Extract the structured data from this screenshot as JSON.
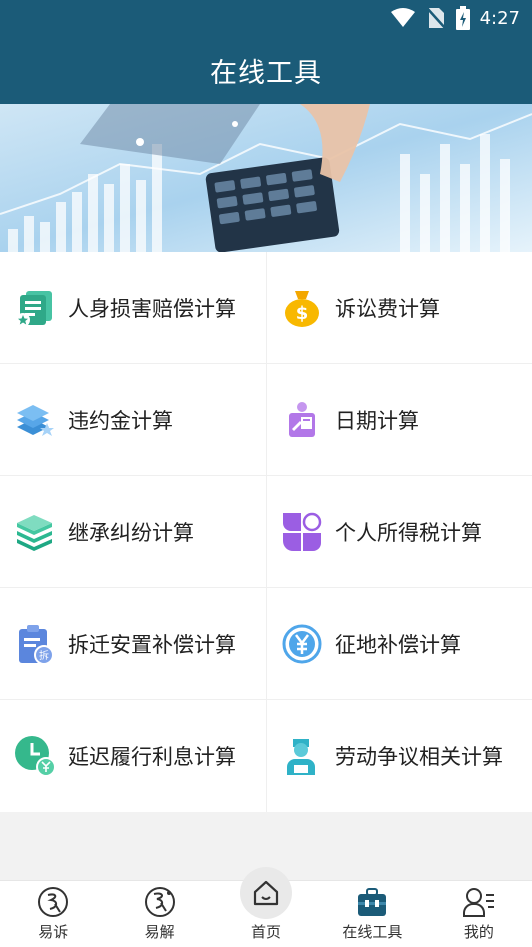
{
  "status": {
    "time": "4:27"
  },
  "header": {
    "title": "在线工具"
  },
  "tools": [
    {
      "label": "人身损害赔偿计算",
      "icon": "injury-document-icon"
    },
    {
      "label": "诉讼费计算",
      "icon": "money-bag-icon"
    },
    {
      "label": "违约金计算",
      "icon": "layers-star-icon"
    },
    {
      "label": "日期计算",
      "icon": "calendar-person-icon"
    },
    {
      "label": "继承纠纷计算",
      "icon": "books-icon"
    },
    {
      "label": "个人所得税计算",
      "icon": "grid-blocks-icon"
    },
    {
      "label": "拆迁安置补偿计算",
      "icon": "clipboard-demolish-icon"
    },
    {
      "label": "征地补偿计算",
      "icon": "yen-circle-icon"
    },
    {
      "label": "延迟履行利息计算",
      "icon": "clock-yen-icon"
    },
    {
      "label": "劳动争议相关计算",
      "icon": "worker-icon"
    }
  ],
  "tabs": [
    {
      "label": "易诉",
      "icon": "yisu-icon"
    },
    {
      "label": "易解",
      "icon": "yijie-icon"
    },
    {
      "label": "首页",
      "icon": "home-icon"
    },
    {
      "label": "在线工具",
      "icon": "toolbox-icon"
    },
    {
      "label": "我的",
      "icon": "profile-icon"
    }
  ]
}
